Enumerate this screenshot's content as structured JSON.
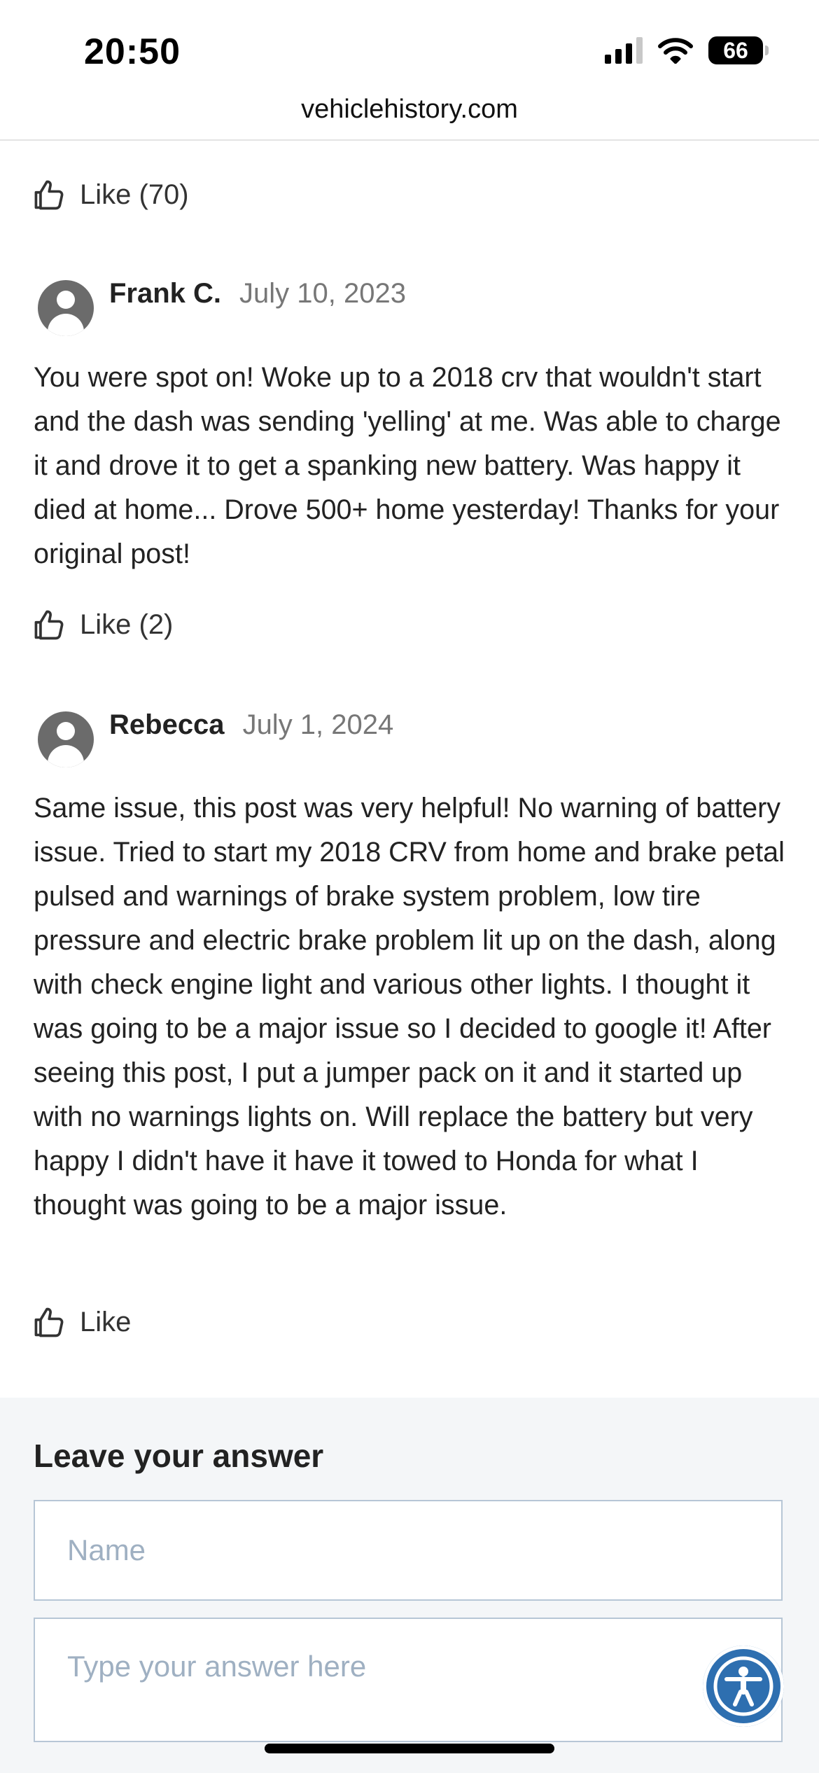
{
  "status_bar": {
    "time": "20:50",
    "battery": "66"
  },
  "browser": {
    "url": "vehiclehistory.com"
  },
  "top_like": {
    "label": "Like (70)"
  },
  "comments": [
    {
      "author": "Frank C.",
      "date": "July 10, 2023",
      "text": "You were spot on! Woke up to a 2018 crv that wouldn't start and the dash was sending 'yelling' at me. Was able to charge it and drove it to get a spanking new battery. Was happy it died at home... Drove 500+ home yesterday! Thanks for your original post!",
      "like_label": "Like (2)"
    },
    {
      "author": "Rebecca",
      "date": "July 1, 2024",
      "text": "Same issue, this post was very helpful! No warning of battery issue. Tried to start my 2018 CRV from home and brake petal pulsed and warnings of brake system problem, low tire pressure and electric brake problem lit up on the dash, along with check engine light and various other lights. I thought it was going to be a major issue so I decided to google it! After seeing this post, I put a jumper pack on it and it started up with no warnings lights on. Will replace the battery but very happy I didn't have it have it towed to Honda for what I thought was going to be a major issue.",
      "like_label": "Like"
    }
  ],
  "answer_form": {
    "title": "Leave your answer",
    "name_placeholder": "Name",
    "answer_placeholder": "Type your answer here"
  },
  "icons": {
    "like": "thumbs-up-icon",
    "avatar": "user-avatar-icon",
    "accessibility": "accessibility-icon",
    "wifi": "wifi-icon",
    "signal": "cellular-signal-icon",
    "battery": "battery-icon"
  },
  "colors": {
    "accessibility_button": "#2e6fb0",
    "form_background": "#f4f6f8",
    "input_border": "#b7c6d6",
    "date_text": "#777777"
  }
}
